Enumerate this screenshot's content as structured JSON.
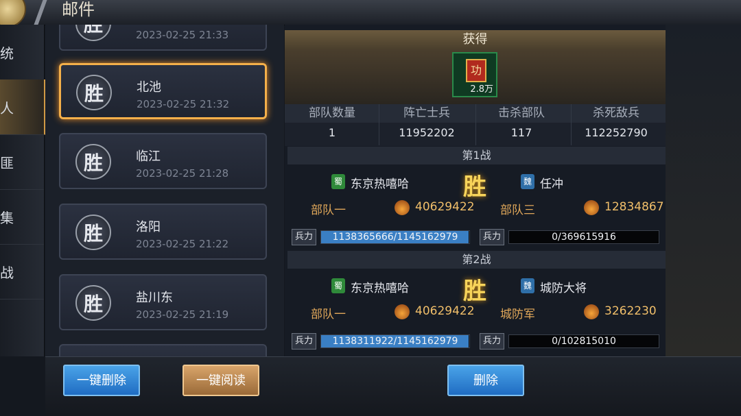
{
  "header": {
    "title": "邮件"
  },
  "left_tabs": [
    {
      "label": "统",
      "active": false
    },
    {
      "label": "人",
      "active": true
    },
    {
      "label": "匪",
      "active": false
    },
    {
      "label": "集",
      "active": false
    },
    {
      "label": "战",
      "active": false
    }
  ],
  "mails": [
    {
      "badge": "胜",
      "name": "",
      "time": "2023-02-25   21:33"
    },
    {
      "badge": "胜",
      "name": "北池",
      "time": "2023-02-25   21:32"
    },
    {
      "badge": "胜",
      "name": "临江",
      "time": "2023-02-25   21:28"
    },
    {
      "badge": "胜",
      "name": "洛阳",
      "time": "2023-02-25   21:22"
    },
    {
      "badge": "胜",
      "name": "盐川东",
      "time": "2023-02-25   21:19"
    }
  ],
  "detail": {
    "gain_title": "获得",
    "reward": {
      "icon_text": "功",
      "amount": "2.8万"
    },
    "stats": {
      "headers": [
        "部队数量",
        "阵亡士兵",
        "击杀部队",
        "杀死敌兵"
      ],
      "values": [
        "1",
        "11952202",
        "117",
        "112252790"
      ]
    },
    "battles": [
      {
        "title": "第1战",
        "result": "胜",
        "left": {
          "flag": "蜀",
          "name": "东京热嘻哈",
          "unit": "部队一",
          "power": "40629422",
          "troop_label": "兵力",
          "troops": "1138365666/1145162979",
          "ratio": 0.994
        },
        "right": {
          "flag": "魏",
          "name": "任冲",
          "unit": "部队三",
          "power": "12834867",
          "troop_label": "兵力",
          "troops": "0/369615916",
          "ratio": 0
        }
      },
      {
        "title": "第2战",
        "result": "胜",
        "left": {
          "flag": "蜀",
          "name": "东京热嘻哈",
          "unit": "部队一",
          "power": "40629422",
          "troop_label": "兵力",
          "troops": "1138311922/1145162979",
          "ratio": 0.994
        },
        "right": {
          "flag": "魏",
          "name": "城防大将",
          "unit": "城防军",
          "power": "3262230",
          "troop_label": "兵力",
          "troops": "0/102815010",
          "ratio": 0
        }
      }
    ]
  },
  "buttons": {
    "delete_all": "一键删除",
    "read_all": "一键阅读",
    "delete": "删除"
  },
  "colors": {
    "shu": "#2f8a3a",
    "wei": "#2f6fa8",
    "accent": "#f5b04a"
  }
}
